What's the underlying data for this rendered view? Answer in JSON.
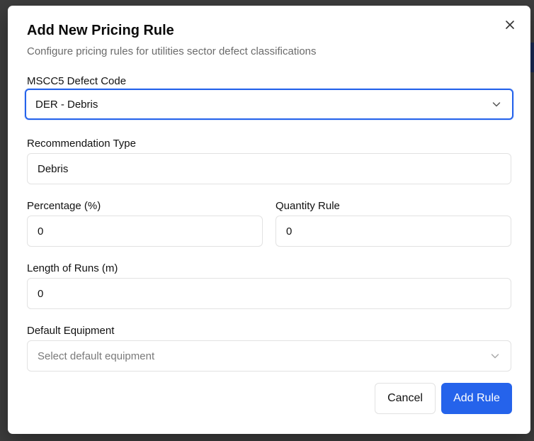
{
  "dialog": {
    "title": "Add New Pricing Rule",
    "subtitle": "Configure pricing rules for utilities sector defect classifications",
    "close_icon": "close-icon"
  },
  "form": {
    "defect_code": {
      "label": "MSCC5 Defect Code",
      "value": "DER - Debris"
    },
    "recommendation_type": {
      "label": "Recommendation Type",
      "value": "Debris"
    },
    "percentage": {
      "label": "Percentage (%)",
      "value": "0"
    },
    "quantity_rule": {
      "label": "Quantity Rule",
      "value": "0"
    },
    "length_of_runs": {
      "label": "Length of Runs (m)",
      "value": "0"
    },
    "default_equipment": {
      "label": "Default Equipment",
      "placeholder": "Select default equipment"
    }
  },
  "actions": {
    "cancel_label": "Cancel",
    "add_label": "Add Rule"
  },
  "colors": {
    "primary": "#2563eb",
    "border": "#e2e2e2",
    "muted_text": "#6b6b6b"
  }
}
